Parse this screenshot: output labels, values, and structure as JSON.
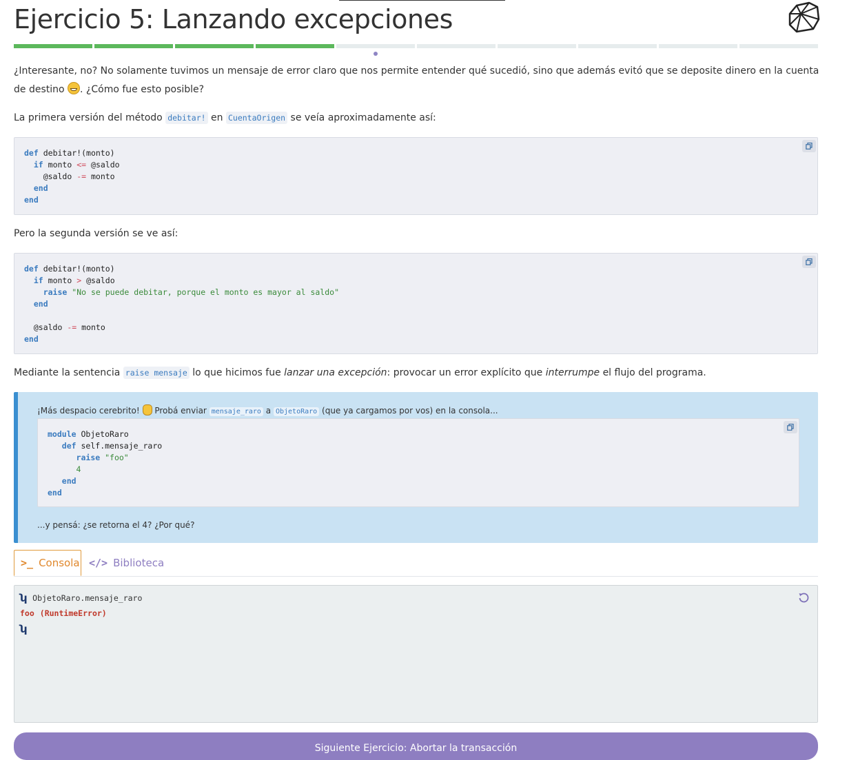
{
  "header": {
    "title": "Ejercicio 5: Lanzando excepciones",
    "progress": {
      "total_segments": 10,
      "completed_segments": 4,
      "current_segment": 5
    }
  },
  "intro": {
    "p1_text": "¿Interesante, no? No solamente tuvimos un mensaje de error claro que nos permite entender qué sucedió, sino que además evitó que se deposite dinero en la cuenta de destino",
    "p1_emoji": "grinning-face-emoji",
    "p1_end": ". ¿Cómo fue esto posible?",
    "p2_pre": "La primera versión del método",
    "p2_code1": "debitar!",
    "p2_mid": "en",
    "p2_code2": "CuentaOrigen",
    "p2_post": "se veía aproximadamente así:"
  },
  "code1": {
    "l1_kw": "def",
    "l1": "debitar!(monto)",
    "l2_kw": "if",
    "l2_a": "monto",
    "l2_op": "<=",
    "l2_b": "@saldo",
    "l3_a": "@saldo",
    "l3_op": "-=",
    "l3_b": "monto",
    "l4_kw": "end",
    "l5_kw": "end"
  },
  "p3": {
    "text": "Pero la segunda versión se ve así:"
  },
  "code2": {
    "l1_kw": "def",
    "l1": "debitar!(monto)",
    "l2_kw": "if",
    "l2_a": "monto",
    "l2_op": ">",
    "l2_b": "@saldo",
    "l3_kw": "raise",
    "l3_str": "\"No se puede debitar, porque el monto es mayor al saldo\"",
    "l4_kw": "end",
    "l6_a": "@saldo",
    "l6_op": "-=",
    "l6_b": "monto",
    "l7_kw": "end"
  },
  "p4": {
    "pre": "Mediante la sentencia",
    "code": "raise mensaje",
    "mid": "lo que hicimos fue",
    "em1": "lanzar una excepción",
    "mid2": ": provocar un error explícito que",
    "em2": "interrumpe",
    "post": "el flujo del programa."
  },
  "tip": {
    "pre": "¡Más despacio cerebrito!",
    "emoji": "raised-hand-emoji",
    "mid": "Probá enviar",
    "code1": "mensaje_raro",
    "a": "a",
    "code2": "ObjetoRaro",
    "post": "(que ya cargamos por vos) en la consola...",
    "code": {
      "l1_kw": "module",
      "l1": "ObjetoRaro",
      "l2_kw": "def",
      "l2": "self.mensaje_raro",
      "l3_kw": "raise",
      "l3_str": "\"foo\"",
      "l4_num": "4",
      "l5_kw": "end",
      "l6_kw": "end"
    },
    "footer": "...y pensá: ¿se retorna el 4? ¿Por qué?"
  },
  "tabs": [
    {
      "label": "Consola",
      "icon": "terminal-icon",
      "active": true
    },
    {
      "label": "Biblioteca",
      "icon": "code-icon",
      "active": false
    }
  ],
  "console": {
    "command": "ObjetoRaro.mensaje_raro",
    "error_msg": "foo",
    "error_type": "(RuntimeError)"
  },
  "next_button": {
    "label": "Siguiente Ejercicio: Abortar la transacción"
  },
  "colors": {
    "progress_done": "#5cb85c",
    "progress_todo": "#e6eced",
    "accent_purple": "#8e7ec1",
    "tip_bg": "#c9e2f3",
    "tip_border": "#3a8fd1",
    "console_tab": "#e0882d",
    "error_red": "#c0392b"
  }
}
